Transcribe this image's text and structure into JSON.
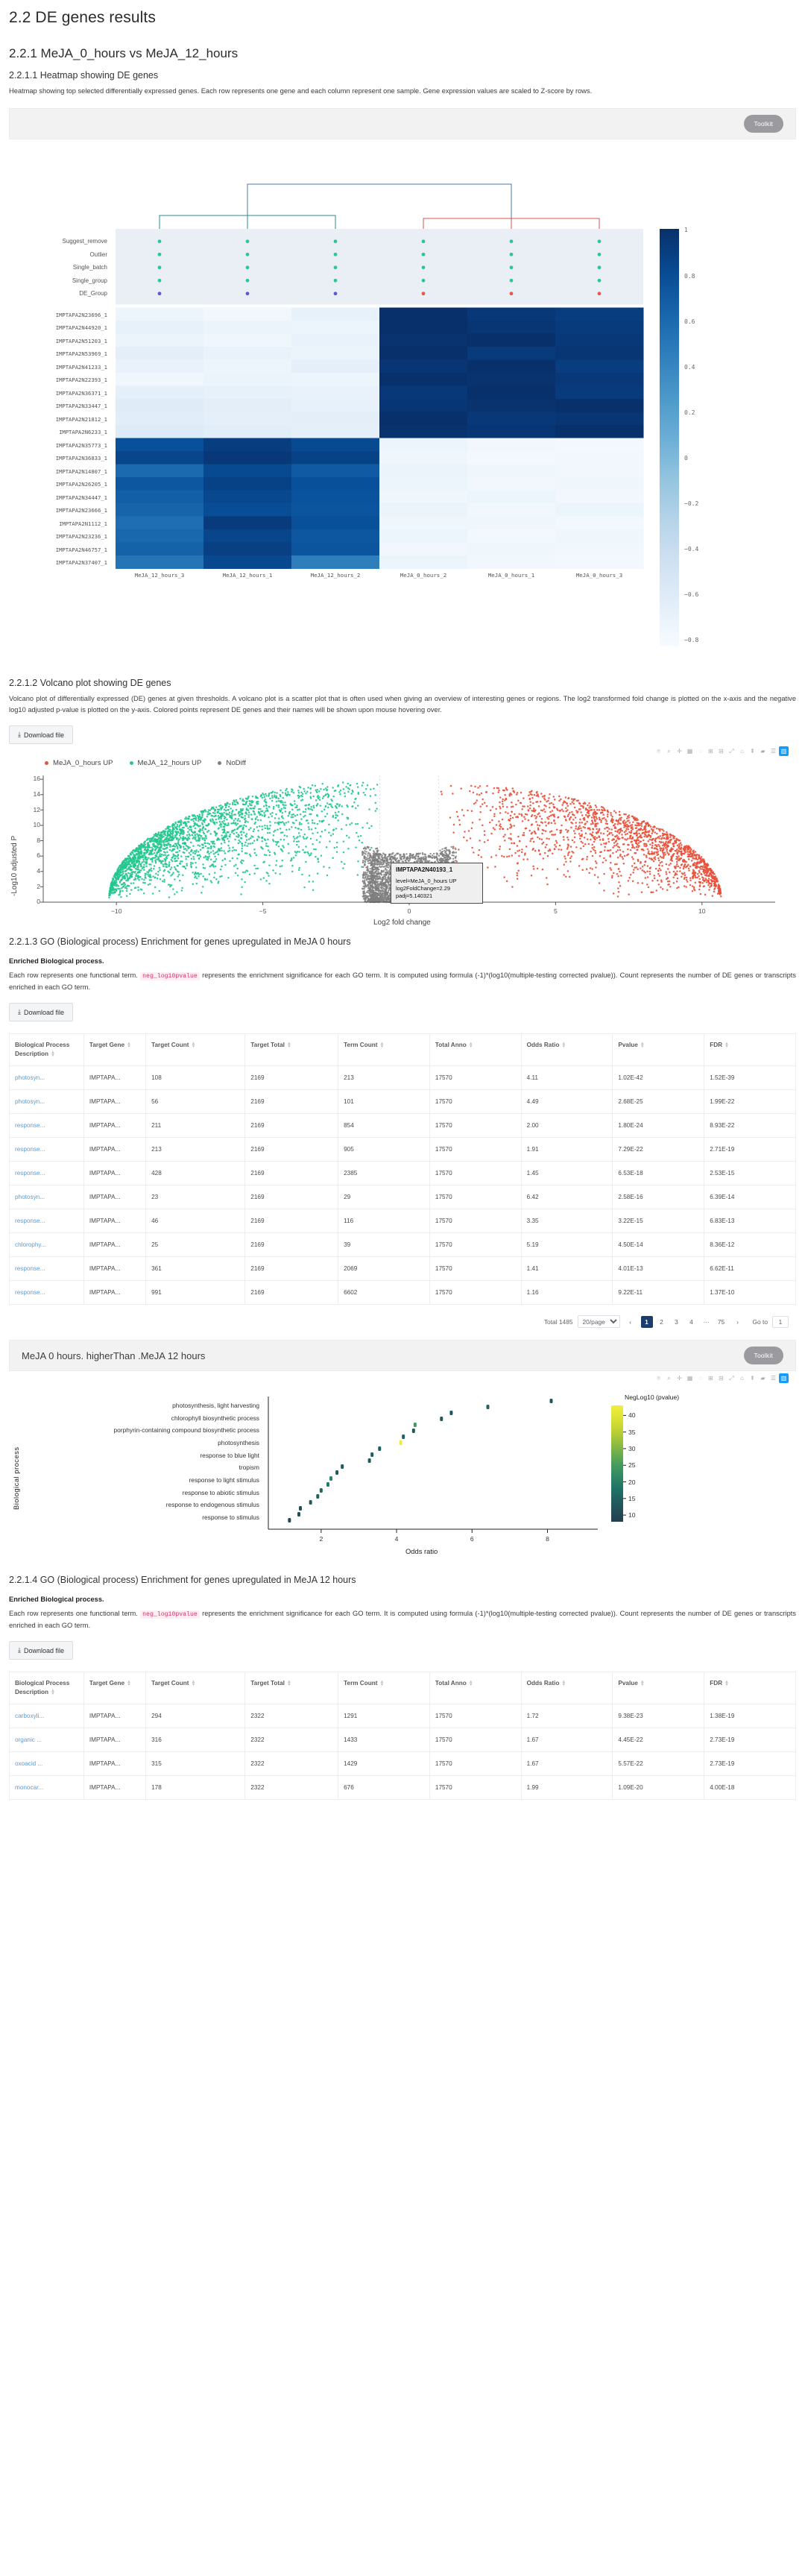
{
  "headings": {
    "h1": "2.2 DE genes results",
    "h2_1": "2.2.1 MeJA_0_hours vs MeJA_12_hours",
    "h3_heatmap": "2.2.1.1 Heatmap showing DE genes",
    "h3_volcano": "2.2.1.2 Volcano plot showing DE genes",
    "h3_go3": "2.2.1.3 GO (Biological process) Enrichment for genes upregulated in MeJA 0 hours",
    "h3_go4": "2.2.1.4 GO (Biological process) Enrichment for genes upregulated in MeJA 12 hours"
  },
  "descriptions": {
    "heatmap": "Heatmap showing top selected differentially expressed genes. Each row represents one gene and each column represent one sample. Gene expression values are scaled to Z-score by rows.",
    "volcano": "Volcano plot of differentially expressed (DE) genes at given thresholds. A volcano plot is a scatter plot that is often used when giving an overview of interesting genes or regions. The log2 transformed fold change is plotted on the x-axis and the negative log10 adjusted p-value is plotted on the y-axis. Colored points represent DE genes and their names will be shown upon mouse hovering over.",
    "go_lead": "Enriched Biological process.",
    "go_body_1": "Each row represents one functional term.",
    "go_code": "neg_log10pvalue",
    "go_body_2": "represents the enrichment significance for each GO term. It is computed using formula (-1)*(log10(multiple-testing corrected pvalue)). Count represents the number of DE genes or transcripts enriched in each GO term."
  },
  "buttons": {
    "toolkit": "Toolkit",
    "download": "Download file",
    "download_icon": "download-arrow-icon"
  },
  "panels": {
    "heatmap_panel_title": "",
    "go_panel_title": "MeJA 0 hours. higherThan .MeJA 12 hours"
  },
  "modebar": {
    "icons": [
      "camera-icon",
      "zoom-icon",
      "pan-icon",
      "box-select-icon",
      "lasso-select-icon",
      "zoom-in-icon",
      "zoom-out-icon",
      "autoscale-icon",
      "home-reset-icon",
      "spike-lines-icon",
      "hover-compare-icon",
      "hover-closest-icon",
      "plotly-logo-icon"
    ]
  },
  "heatmap": {
    "annotation_rows": [
      "Suggest_remove",
      "Outlier",
      "Single_batch",
      "Single_group",
      "DE_Group"
    ],
    "gene_rows": [
      "IMPTAPA2N23696_1",
      "IMPTAPA2N44920_1",
      "IMPTAPA2N51203_1",
      "IMPTAPA2N53969_1",
      "IMPTAPA2N41233_1",
      "IMPTAPA2N22393_1",
      "IMPTAPA2N36371_1",
      "IMPTAPA2N33447_1",
      "IMPTAPA2N21812_1",
      "IMPTAPA2N6233_1",
      "IMPTAPA2N35773_1",
      "IMPTAPA2N36833_1",
      "IMPTAPA2N14807_1",
      "IMPTAPA2N26205_1",
      "IMPTAPA2N34447_1",
      "IMPTAPA2N23666_1",
      "IMPTAPA2N1112_1",
      "IMPTAPA2N23236_1",
      "IMPTAPA2N46757_1",
      "IMPTAPA2N37407_1"
    ],
    "columns": [
      "MeJA_12_hours_3",
      "MeJA_12_hours_1",
      "MeJA_12_hours_2",
      "MeJA_0_hours_2",
      "MeJA_0_hours_1",
      "MeJA_0_hours_3"
    ],
    "colorbar_ticks": [
      "1",
      "0.8",
      "0.6",
      "0.4",
      "0.2",
      "0",
      "−0.2",
      "−0.4",
      "−0.6",
      "−0.8"
    ],
    "annotation_colors": {
      "teal": "#2ec4a0",
      "blue": "#5a5ad6",
      "red": "#e8574a"
    },
    "annotation_dots": [
      [
        "teal",
        "teal",
        "teal",
        "teal",
        "teal",
        "teal"
      ],
      [
        "teal",
        "teal",
        "teal",
        "teal",
        "teal",
        "teal"
      ],
      [
        "teal",
        "teal",
        "teal",
        "teal",
        "teal",
        "teal"
      ],
      [
        "teal",
        "teal",
        "teal",
        "teal",
        "teal",
        "teal"
      ],
      [
        "blue",
        "blue",
        "blue",
        "red",
        "red",
        "red"
      ]
    ],
    "values": [
      [
        0.05,
        0.03,
        0.08,
        1.0,
        0.97,
        0.95
      ],
      [
        0.08,
        0.06,
        0.05,
        1.0,
        0.98,
        0.96
      ],
      [
        0.06,
        0.04,
        0.07,
        0.99,
        1.0,
        0.97
      ],
      [
        0.1,
        0.07,
        0.06,
        1.0,
        0.96,
        0.98
      ],
      [
        0.07,
        0.05,
        0.09,
        0.98,
        1.0,
        0.95
      ],
      [
        0.04,
        0.06,
        0.05,
        1.0,
        0.99,
        0.97
      ],
      [
        0.09,
        0.08,
        0.07,
        0.97,
        1.0,
        0.96
      ],
      [
        0.12,
        0.1,
        0.08,
        0.98,
        0.99,
        1.0
      ],
      [
        0.11,
        0.09,
        0.1,
        1.0,
        0.97,
        0.98
      ],
      [
        0.13,
        0.11,
        0.09,
        0.99,
        0.98,
        1.0
      ],
      [
        0.88,
        0.95,
        0.9,
        0.05,
        0.03,
        0.02
      ],
      [
        0.92,
        0.97,
        0.93,
        0.04,
        0.02,
        0.03
      ],
      [
        0.78,
        0.9,
        0.84,
        0.06,
        0.04,
        0.03
      ],
      [
        0.85,
        0.93,
        0.88,
        0.05,
        0.03,
        0.04
      ],
      [
        0.82,
        0.91,
        0.87,
        0.04,
        0.05,
        0.03
      ],
      [
        0.8,
        0.89,
        0.86,
        0.06,
        0.03,
        0.05
      ],
      [
        0.76,
        0.96,
        0.88,
        0.04,
        0.04,
        0.02
      ],
      [
        0.79,
        0.92,
        0.85,
        0.05,
        0.02,
        0.04
      ],
      [
        0.81,
        0.94,
        0.86,
        0.03,
        0.04,
        0.03
      ],
      [
        0.74,
        0.91,
        0.7,
        0.05,
        0.03,
        0.02
      ]
    ]
  },
  "volcano": {
    "legend": [
      {
        "label": "MeJA_0_hours UP",
        "color": "#e8503a"
      },
      {
        "label": "MeJA_12_hours UP",
        "color": "#24c78e"
      },
      {
        "label": "NoDiff",
        "color": "#7f7f7f"
      }
    ],
    "xlabel": "Log2 fold change",
    "ylabel": "-Log10 adjusted P",
    "xticks": [
      "−10",
      "−5",
      "0",
      "5",
      "10"
    ],
    "yticks": [
      "16",
      "14",
      "12",
      "10",
      "8",
      "6",
      "4",
      "2",
      "0"
    ],
    "xlim": [
      -12.5,
      12.5
    ],
    "ylim": [
      0,
      16.5
    ],
    "tooltip": {
      "gene": "IMPTAPA2N40193_1",
      "level": "level=MeJA_0_hours UP",
      "log2fc": "log2FoldChange=2.29",
      "padj": "padj=5.140321"
    }
  },
  "go_table_1": {
    "headers": [
      "Biological Process Description",
      "Target Gene",
      "Target Count",
      "Target Total",
      "Term Count",
      "Total Anno",
      "Odds Ratio",
      "Pvalue",
      "FDR"
    ],
    "rows": [
      [
        "photosyn...",
        "IMPTAPA...",
        "108",
        "2169",
        "213",
        "17570",
        "4.11",
        "1.02E-42",
        "1.52E-39"
      ],
      [
        "photosyn...",
        "IMPTAPA...",
        "56",
        "2169",
        "101",
        "17570",
        "4.49",
        "2.68E-25",
        "1.99E-22"
      ],
      [
        "response...",
        "IMPTAPA...",
        "211",
        "2169",
        "854",
        "17570",
        "2.00",
        "1.80E-24",
        "8.93E-22"
      ],
      [
        "response...",
        "IMPTAPA...",
        "213",
        "2169",
        "905",
        "17570",
        "1.91",
        "7.29E-22",
        "2.71E-19"
      ],
      [
        "response...",
        "IMPTAPA...",
        "428",
        "2169",
        "2385",
        "17570",
        "1.45",
        "6.53E-18",
        "2.53E-15"
      ],
      [
        "photosyn...",
        "IMPTAPA...",
        "23",
        "2169",
        "29",
        "17570",
        "6.42",
        "2.58E-16",
        "6.39E-14"
      ],
      [
        "response...",
        "IMPTAPA...",
        "46",
        "2169",
        "116",
        "17570",
        "3.35",
        "3.22E-15",
        "6.83E-13"
      ],
      [
        "chlorophy...",
        "IMPTAPA...",
        "25",
        "2169",
        "39",
        "17570",
        "5.19",
        "4.50E-14",
        "8.36E-12"
      ],
      [
        "response...",
        "IMPTAPA...",
        "361",
        "2169",
        "2069",
        "17570",
        "1.41",
        "4.01E-13",
        "6.62E-11"
      ],
      [
        "response...",
        "IMPTAPA...",
        "991",
        "2169",
        "6602",
        "17570",
        "1.16",
        "9.22E-11",
        "1.37E-10"
      ]
    ]
  },
  "go_table_2": {
    "headers": [
      "Biological Process Description",
      "Target Gene",
      "Target Count",
      "Target Total",
      "Term Count",
      "Total Anno",
      "Odds Ratio",
      "Pvalue",
      "FDR"
    ],
    "rows": [
      [
        "carboxyli...",
        "IMPTAPA...",
        "294",
        "2322",
        "1291",
        "17570",
        "1.72",
        "9.38E-23",
        "1.38E-19"
      ],
      [
        "organic ...",
        "IMPTAPA...",
        "316",
        "2322",
        "1433",
        "17570",
        "1.67",
        "4.45E-22",
        "2.73E-19"
      ],
      [
        "oxoacid ...",
        "IMPTAPA...",
        "315",
        "2322",
        "1429",
        "17570",
        "1.67",
        "5.57E-22",
        "2.73E-19"
      ],
      [
        "monocar...",
        "IMPTAPA...",
        "178",
        "2322",
        "676",
        "17570",
        "1.99",
        "1.09E-20",
        "4.00E-18"
      ]
    ]
  },
  "pagination": {
    "total": "Total 1485",
    "per_page": "20/page",
    "prev": "‹",
    "next": "›",
    "pages": [
      "1",
      "2",
      "3",
      "4",
      "···",
      "75"
    ],
    "current": "1",
    "goto_label": "Go to",
    "goto_value": "1"
  },
  "chart_data": {
    "type": "scatter",
    "title": "GO Biological process dot plot — MeJA 0 hours higherThan MeJA 12 hours",
    "xlabel": "Odds ratio",
    "ylabel": "Biological process",
    "xticks": [
      "2",
      "4",
      "6",
      "8"
    ],
    "xlim": [
      0.6,
      8.9
    ],
    "legend_title": "NegLog10 (pvalue)",
    "legend_ticks": [
      "40",
      "35",
      "30",
      "25",
      "20",
      "15",
      "10"
    ],
    "legend_range": [
      8,
      43
    ],
    "legend_position": "right",
    "grid": false,
    "categories": [
      "photosynthesis, light harvesting",
      "chlorophyll biosynthetic process",
      "porphyrin-containing compound biosynthetic process",
      "photosynthesis",
      "response to blue light",
      "tropism",
      "response to light stimulus",
      "response to abiotic stimulus",
      "response to endogenous stimulus",
      "response to stimulus"
    ],
    "points": [
      {
        "odds_ratio": 8.1,
        "neglog10p": 13.0
      },
      {
        "odds_ratio": 6.42,
        "neglog10p": 15.6
      },
      {
        "odds_ratio": 5.45,
        "neglog10p": 13.2
      },
      {
        "odds_ratio": 5.19,
        "neglog10p": 13.3
      },
      {
        "odds_ratio": 4.49,
        "neglog10p": 24.6
      },
      {
        "odds_ratio": 4.45,
        "neglog10p": 14.0
      },
      {
        "odds_ratio": 4.18,
        "neglog10p": 15.5
      },
      {
        "odds_ratio": 4.11,
        "neglog10p": 42.0
      },
      {
        "odds_ratio": 3.55,
        "neglog10p": 14.5
      },
      {
        "odds_ratio": 3.35,
        "neglog10p": 14.8
      },
      {
        "odds_ratio": 3.28,
        "neglog10p": 14.0
      },
      {
        "odds_ratio": 2.56,
        "neglog10p": 13.5
      },
      {
        "odds_ratio": 2.42,
        "neglog10p": 13.2
      },
      {
        "odds_ratio": 2.26,
        "neglog10p": 21.0
      },
      {
        "odds_ratio": 2.18,
        "neglog10p": 19.0
      },
      {
        "odds_ratio": 2.0,
        "neglog10p": 16.0
      },
      {
        "odds_ratio": 1.91,
        "neglog10p": 15.0
      },
      {
        "odds_ratio": 1.72,
        "neglog10p": 14.2
      },
      {
        "odds_ratio": 1.45,
        "neglog10p": 12.0
      },
      {
        "odds_ratio": 1.41,
        "neglog10p": 11.5
      },
      {
        "odds_ratio": 1.16,
        "neglog10p": 10.0
      }
    ]
  }
}
